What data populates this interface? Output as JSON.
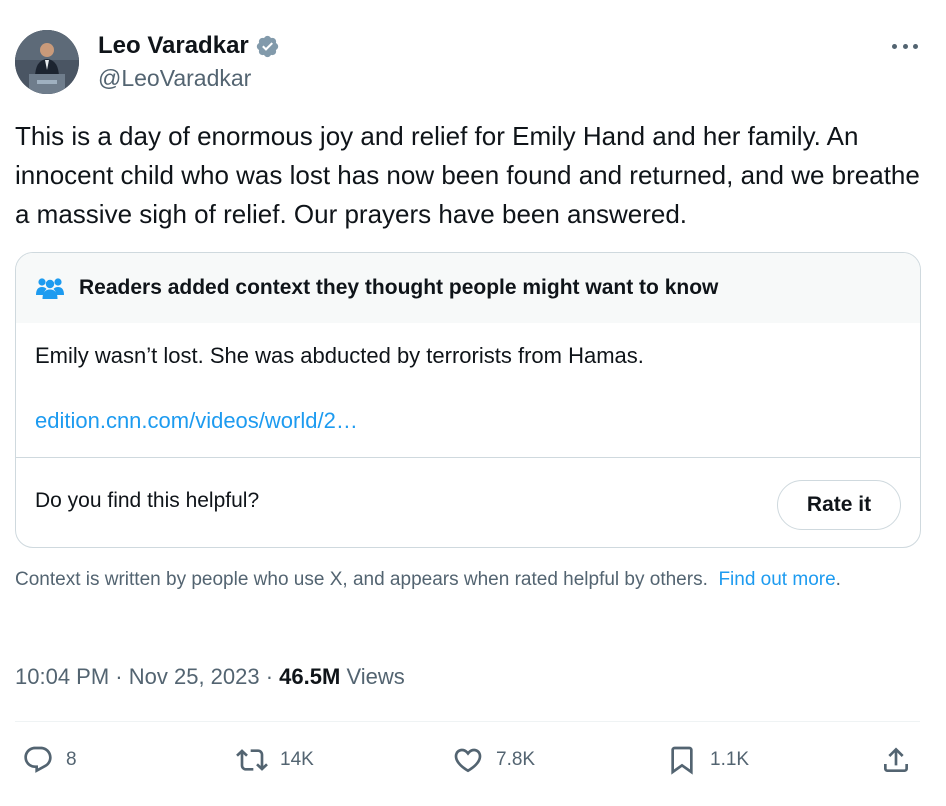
{
  "author": {
    "name": "Leo Varadkar",
    "handle": "@LeoVaradkar",
    "verified_color": "#829aab"
  },
  "tweet": {
    "text": "This is a day of enormous joy and relief for Emily Hand and her family. An innocent child who was lost has now been found and returned, and we breathe a massive sigh of relief.  Our prayers have been answered."
  },
  "community_note": {
    "header_icon": "people-icon",
    "title": "Readers added context they thought people might want to know",
    "body": "Emily wasn’t lost. She was abducted by terrorists from Hamas.",
    "link": "edition.cnn.com/videos/world/2…",
    "helpful_question": "Do you find this helpful?",
    "rate_label": "Rate it"
  },
  "context_disclaimer": {
    "text": "Context is written by people who use X, and appears when rated helpful by others.",
    "link_text": "Find out more",
    "end_punct": "."
  },
  "meta": {
    "time": "10:04 PM",
    "sep1": " · ",
    "date": "Nov 25, 2023",
    "sep2": " · ",
    "views_count": "46.5M",
    "views_label": " Views"
  },
  "actions": {
    "replies": "8",
    "reposts": "14K",
    "likes": "7.8K",
    "bookmarks": "1.1K"
  },
  "colors": {
    "text": "#0f1419",
    "secondary": "#536471",
    "link": "#1d9bf0",
    "border": "#cfd9de",
    "note_header_bg": "#f7f9f9"
  }
}
